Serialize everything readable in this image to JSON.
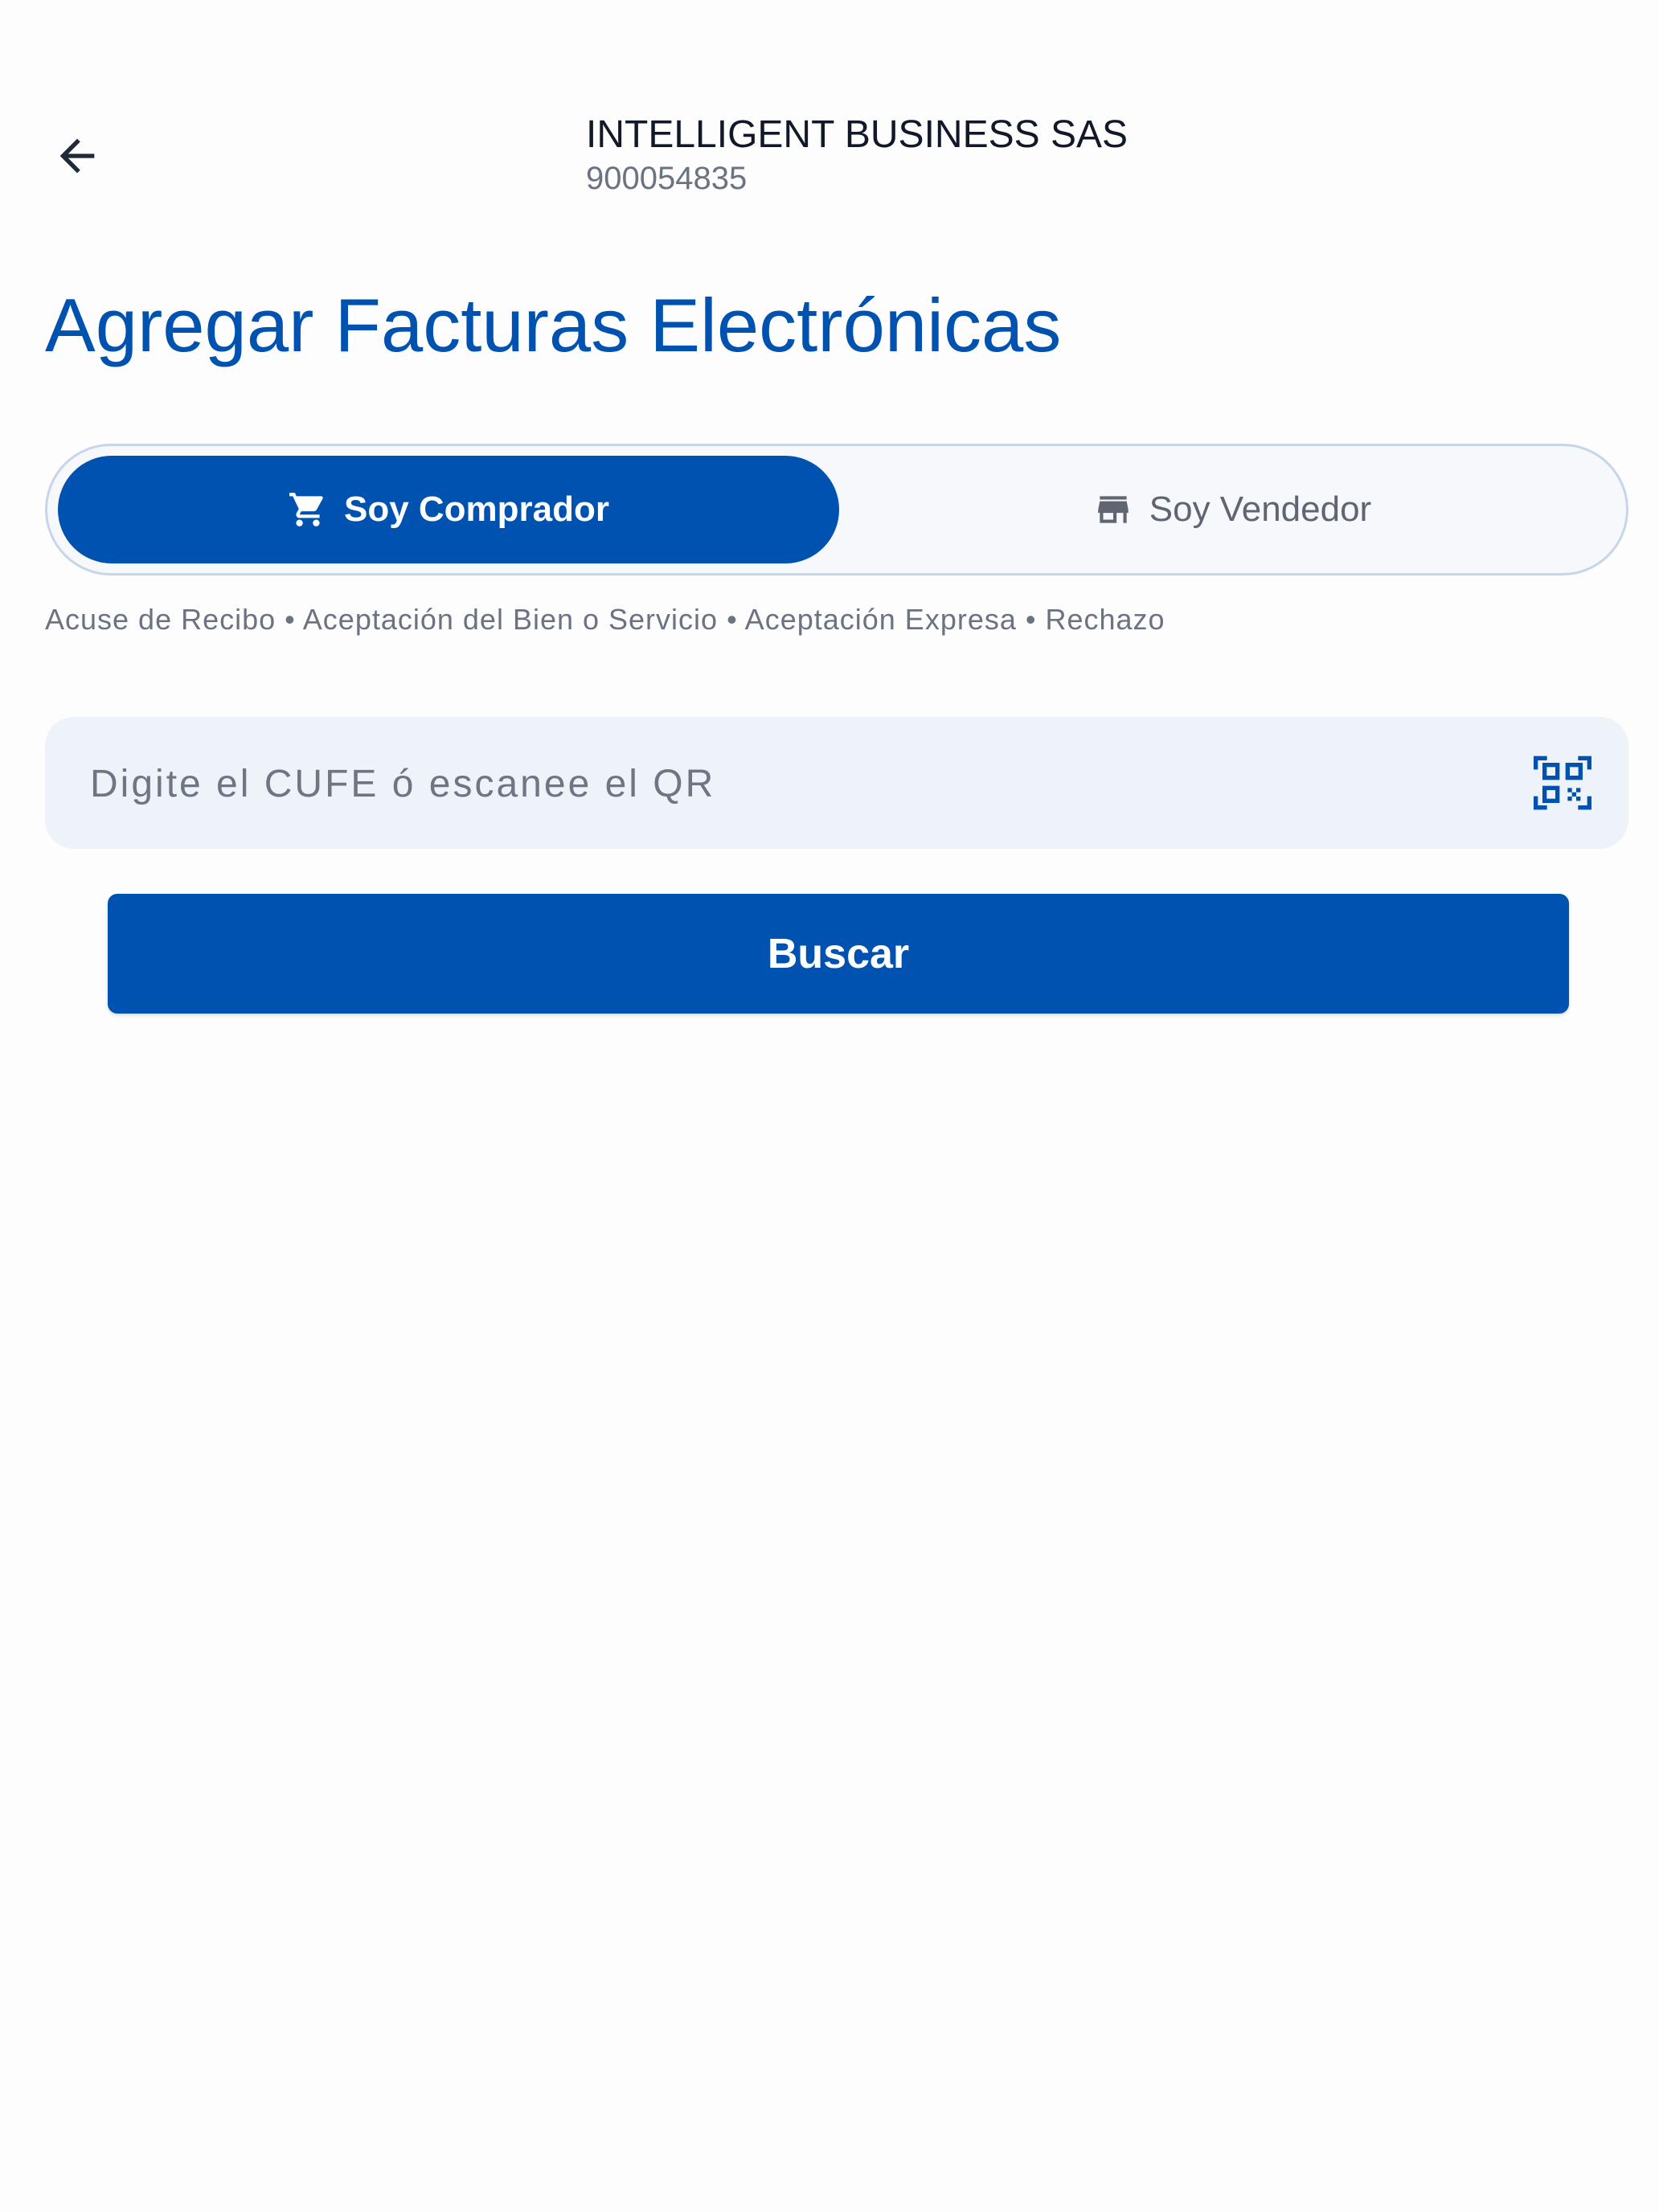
{
  "header": {
    "back_icon": "arrow-left-icon",
    "company_name": "INTELLIGENT BUSINESS SAS",
    "company_nit": "900054835"
  },
  "page": {
    "title": "Agregar Facturas Electrónicas"
  },
  "role_toggle": {
    "buyer_label": "Soy Comprador",
    "buyer_icon": "shopping-cart-icon",
    "seller_label": "Soy Vendedor",
    "seller_icon": "store-icon",
    "selected": "buyer"
  },
  "event_types": "Acuse de Recibo • Aceptación del Bien o Servicio • Aceptación Expresa • Rechazo",
  "search": {
    "placeholder": "Digite el CUFE ó escanee el QR",
    "value": "",
    "qr_icon": "qr-code-scan-icon"
  },
  "actions": {
    "search_label": "Buscar"
  },
  "colors": {
    "primary": "#0052b0",
    "selected_text": "#ffffff",
    "unselected_text": "#5f6672",
    "field_background": "#eef3f9"
  }
}
